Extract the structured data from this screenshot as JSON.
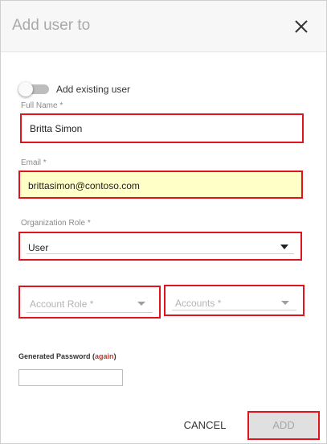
{
  "dialog": {
    "title": "Add user to",
    "close_icon": "close-icon"
  },
  "toggle": {
    "label": "Add existing user",
    "checked": false
  },
  "full_name": {
    "label": "Full Name *",
    "value": "Britta Simon"
  },
  "email": {
    "label": "Email *",
    "value": "brittasimon@contoso.com",
    "background": "#ffffc8"
  },
  "organization_role": {
    "label": "Organization Role *",
    "value": "User",
    "icon": "chevron-down-icon"
  },
  "account_role": {
    "placeholder": "Account Role *",
    "icon": "chevron-down-icon"
  },
  "accounts": {
    "placeholder": "Accounts *",
    "icon": "chevron-down-icon"
  },
  "generated_password": {
    "label": "Generated Password",
    "open_paren": " (",
    "again_link": "again",
    "close_paren": ")",
    "value": ""
  },
  "buttons": {
    "cancel": "CANCEL",
    "add": "ADD"
  },
  "colors": {
    "highlight_border": "#e3131d",
    "link": "#c0392b",
    "disabled_button": "#e0e0e0"
  }
}
